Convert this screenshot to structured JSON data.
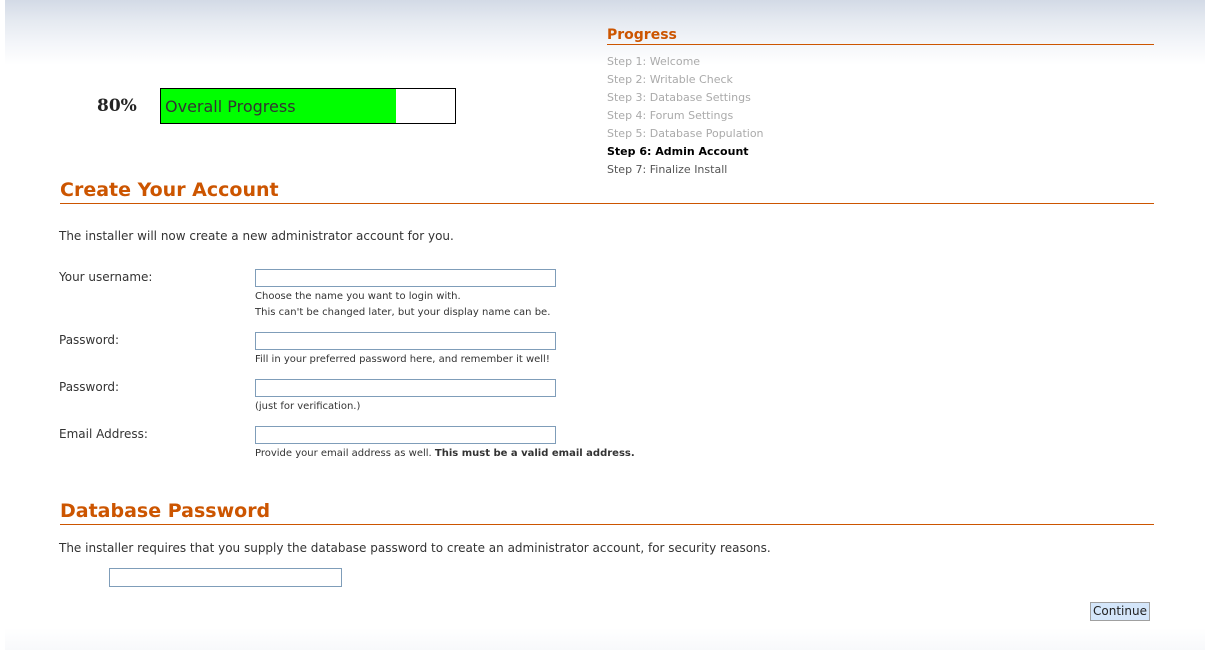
{
  "progress": {
    "percent_label": "80%",
    "value_percent": 80,
    "bar_label": "Overall Progress",
    "fill_color": "#00ff00"
  },
  "steps": {
    "title": "Progress",
    "items": [
      {
        "label": "Step 1: Welcome",
        "state": "done"
      },
      {
        "label": "Step 2: Writable Check",
        "state": "done"
      },
      {
        "label": "Step 3: Database Settings",
        "state": "done"
      },
      {
        "label": "Step 4: Forum Settings",
        "state": "done"
      },
      {
        "label": "Step 5: Database Population",
        "state": "done"
      },
      {
        "label": "Step 6: Admin Account",
        "state": "current"
      },
      {
        "label": "Step 7: Finalize Install",
        "state": "future"
      }
    ]
  },
  "account": {
    "title": "Create Your Account",
    "intro": "The installer will now create a new administrator account for you.",
    "fields": {
      "username": {
        "label": "Your username:",
        "value": "",
        "hint_line1": "Choose the name you want to login with.",
        "hint_line2": "This can't be changed later, but your display name can be."
      },
      "password": {
        "label": "Password:",
        "value": "",
        "hint": "Fill in your preferred password here, and remember it well!"
      },
      "password_confirm": {
        "label": "Password:",
        "value": "",
        "hint": "(just for verification.)"
      },
      "email": {
        "label": "Email Address:",
        "value": "",
        "hint": "Provide your email address as well.",
        "hint_bold": "This must be a valid email address."
      }
    }
  },
  "database": {
    "title": "Database Password",
    "intro": "The installer requires that you supply the database password to create an administrator account, for security reasons.",
    "password_value": ""
  },
  "actions": {
    "continue_label": "Continue"
  },
  "colors": {
    "accent": "#cc5500",
    "progress_fill": "#00ff00",
    "input_border": "#7f9db9",
    "button_bg": "#d4e6fa"
  }
}
